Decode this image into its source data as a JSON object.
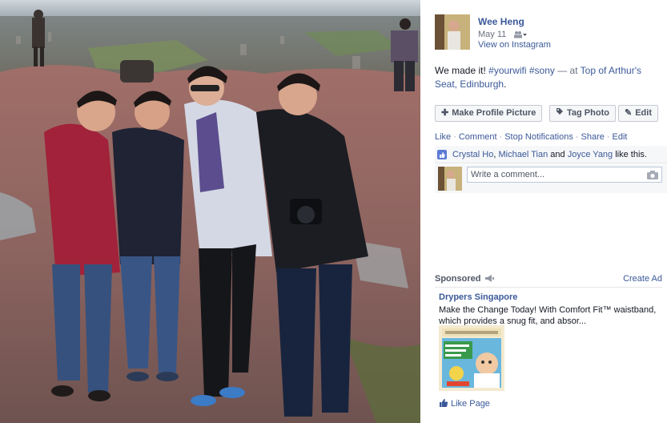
{
  "post": {
    "owner_name": "Wee Heng",
    "date": "May 11",
    "via": "View on Instagram",
    "caption_text": "We made it! ",
    "hashtag1": "#yourwifi",
    "hashtag2": "#sony",
    "dash_at": " — at ",
    "location": "Top of Arthur's Seat, Edinburgh",
    "period": "."
  },
  "buttons": {
    "make_profile": "Make Profile Picture",
    "tag_photo": "Tag Photo",
    "edit": "Edit"
  },
  "actions": {
    "like": "Like",
    "comment": "Comment",
    "stop_notifications": "Stop Notifications",
    "share": "Share",
    "edit": "Edit",
    "sep": "·"
  },
  "likes": {
    "person1": "Crystal Ho",
    "comma": ", ",
    "person2": "Michael Tian",
    "and": " and ",
    "person3": "Joyce Yang",
    "suffix": " like this."
  },
  "comment_box": {
    "placeholder": "Write a comment..."
  },
  "sponsored": {
    "heading": "Sponsored",
    "create_ad": "Create Ad",
    "ad_title": "Drypers Singapore",
    "ad_body": "Make the Change Today! With Comfort Fit™ waistband, which provides a snug fit, and absor...",
    "like_page": "Like Page"
  },
  "colors": {
    "link": "#3b5998",
    "muted": "#6a7180",
    "button_bg": "#f6f7f9"
  }
}
